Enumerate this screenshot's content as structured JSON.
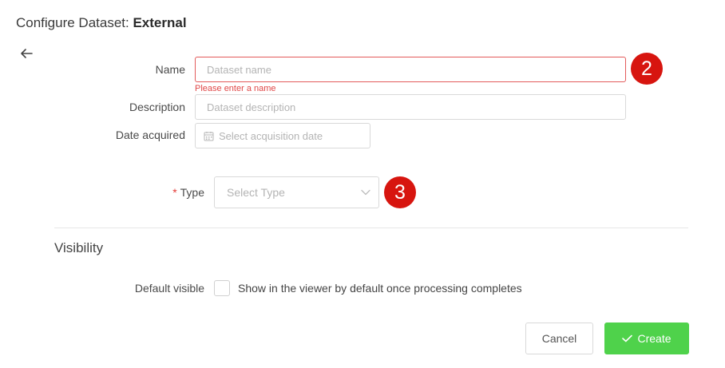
{
  "header": {
    "title_prefix": "Configure Dataset: ",
    "title_bold": "External"
  },
  "form": {
    "name": {
      "label": "Name",
      "placeholder": "Dataset name",
      "value": "",
      "error": "Please enter a name"
    },
    "description": {
      "label": "Description",
      "placeholder": "Dataset description",
      "value": ""
    },
    "date_acquired": {
      "label": "Date acquired",
      "placeholder": "Select acquisition date"
    },
    "type": {
      "required_marker": "*",
      "label": "Type",
      "placeholder": "Select Type"
    }
  },
  "badges": {
    "name_step": "2",
    "type_step": "3"
  },
  "visibility": {
    "section_title": "Visibility",
    "default_visible_label": "Default visible",
    "checkbox_text": "Show in the viewer by default once processing completes",
    "checked": false
  },
  "actions": {
    "cancel_label": "Cancel",
    "create_label": "Create"
  },
  "colors": {
    "error": "#e35a5a",
    "badge": "#d7150f",
    "create_button": "#4fd24b",
    "required": "#e53935"
  },
  "icons": {
    "back": "arrow-left-icon",
    "calendar": "calendar-icon",
    "chevron": "chevron-down-icon",
    "check": "check-icon"
  }
}
